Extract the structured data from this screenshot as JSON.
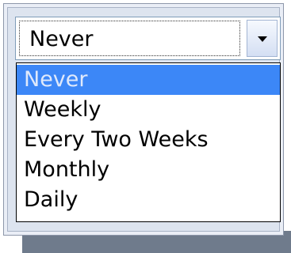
{
  "select": {
    "value": "Never",
    "options": [
      "Never",
      "Weekly",
      "Every Two Weeks",
      "Monthly",
      "Daily"
    ],
    "selected_index": 0
  },
  "colors": {
    "highlight": "#3c87f7",
    "highlight_text": "#dfe9fb",
    "frame": "#dde4ef",
    "shadow": "#6f7b8c"
  },
  "icons": {
    "dropdown_button": "chevron-down-icon"
  }
}
